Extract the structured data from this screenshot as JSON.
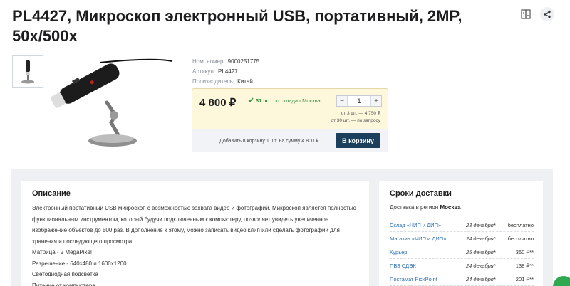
{
  "product": {
    "title": "PL4427, Микроскоп электронный USB, портативный, 2MP, 50x/500x"
  },
  "top_icons": [
    "compare-icon",
    "share-icon"
  ],
  "specs": [
    {
      "label": "Ном. номер:",
      "value": "9000251775"
    },
    {
      "label": "Артикул:",
      "value": "PL4427"
    },
    {
      "label": "Производитель:",
      "value": "Китай"
    }
  ],
  "buy": {
    "price": "4 800 ₽",
    "stock_count": "31 шт.",
    "stock_text": "со склада г.Москва",
    "quantity": "1",
    "minus": "−",
    "plus": "+",
    "tier1": "от 3 шт. — 4 750 ₽",
    "tier2": "от 30 шт. — по запросу",
    "add_sum": "Добавить в корзину 1 шт. на сумму 4 800 ₽",
    "cart_button": "В корзину"
  },
  "description": {
    "heading": "Описание",
    "lines": [
      "Электронный портативный USB микроскоп с возможностью захвата видео и фотографий. Микроскоп является полностью функциональным инструментом, который будучи подключенным к компьютеру, позволяет увидеть увеличенное изображение объектов до 500 раз. В дополнение к этому, можно записать видео клип или сделать фотографии для хранения и последующего просмотра.",
      "Матрица - 2 MegaPixel",
      "Разрешение - 640x480 и 1600x1200",
      "Светодиодная подсветка",
      "Питание от компьютера"
    ]
  },
  "delivery": {
    "heading": "Сроки доставки",
    "region_label": "Доставка в регион",
    "region": "Москва",
    "rows": [
      {
        "method": "Склад «ЧИП и ДИП»",
        "date": "23 декабря*",
        "cost": "бесплатно"
      },
      {
        "method": "Магазин «ЧИП и ДИП»",
        "date": "24 декабря*",
        "cost": "бесплатно"
      },
      {
        "method": "Курьер",
        "date": "25 декабря*",
        "cost": "350 ₽**"
      },
      {
        "method": "ПВЗ СДЭК",
        "date": "24 декабря*",
        "cost": "138 ₽**"
      },
      {
        "method": "Постамат PickPoint",
        "date": "24 декабря*",
        "cost": "201 ₽**"
      }
    ]
  },
  "colors": {
    "accent": "#1b3f5d",
    "link": "#2b6fb3",
    "stock_green": "#2e8b3a",
    "buybox_bg": "#fdf7dc"
  }
}
